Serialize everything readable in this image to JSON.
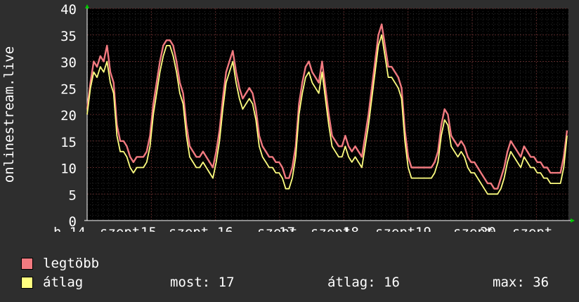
{
  "chart_data": {
    "type": "line",
    "ylabel": "onlinestream.live",
    "ylim": [
      0,
      40
    ],
    "yticks": [
      0,
      5,
      10,
      15,
      20,
      25,
      30,
      35,
      40
    ],
    "xtick_labels": [
      "h 14",
      "szept",
      "15",
      "szept",
      "16",
      "szept",
      "17",
      "szept",
      "18",
      "szept",
      "19",
      "szept",
      "20",
      "szept"
    ],
    "grid": true,
    "days": 7.5,
    "series": [
      {
        "name": "legtöbb",
        "color": "#f27a80",
        "values": [
          21,
          26,
          30,
          29,
          31,
          30,
          33,
          28,
          26,
          18,
          15,
          15,
          14,
          12,
          11,
          12,
          12,
          12,
          13,
          16,
          22,
          26,
          30,
          33,
          34,
          34,
          33,
          30,
          26,
          24,
          18,
          14,
          13,
          12,
          12,
          13,
          12,
          11,
          10,
          13,
          17,
          23,
          28,
          30,
          32,
          28,
          25,
          23,
          24,
          25,
          24,
          21,
          16,
          14,
          13,
          12,
          12,
          11,
          11,
          10,
          8,
          8,
          10,
          14,
          22,
          26,
          29,
          30,
          28,
          27,
          26,
          30,
          25,
          20,
          16,
          15,
          14,
          14,
          16,
          14,
          13,
          14,
          13,
          12,
          16,
          20,
          25,
          30,
          35,
          37,
          33,
          29,
          29,
          28,
          27,
          25,
          17,
          12,
          10,
          10,
          10,
          10,
          10,
          10,
          10,
          11,
          13,
          18,
          21,
          20,
          16,
          15,
          14,
          15,
          14,
          12,
          11,
          11,
          10,
          9,
          8,
          7,
          7,
          6,
          6,
          8,
          10,
          13,
          15,
          14,
          13,
          12,
          14,
          13,
          12,
          12,
          11,
          11,
          10,
          10,
          9,
          9,
          9,
          9,
          12,
          17
        ]
      },
      {
        "name": "átlag",
        "color": "#ffff80",
        "values": [
          20,
          25,
          28,
          27,
          29,
          28,
          30,
          26,
          24,
          16,
          13,
          13,
          12,
          10,
          9,
          10,
          10,
          10,
          11,
          14,
          20,
          24,
          28,
          31,
          33,
          33,
          31,
          28,
          24,
          22,
          16,
          12,
          11,
          10,
          10,
          11,
          10,
          9,
          8,
          11,
          15,
          21,
          26,
          28,
          30,
          26,
          23,
          21,
          22,
          23,
          22,
          19,
          14,
          12,
          11,
          10,
          10,
          9,
          9,
          8,
          6,
          6,
          8,
          12,
          20,
          24,
          27,
          28,
          26,
          25,
          24,
          28,
          23,
          18,
          14,
          13,
          12,
          12,
          14,
          12,
          11,
          12,
          11,
          10,
          14,
          18,
          23,
          28,
          33,
          35,
          31,
          27,
          27,
          26,
          25,
          23,
          15,
          10,
          8,
          8,
          8,
          8,
          8,
          8,
          8,
          9,
          11,
          16,
          19,
          18,
          14,
          13,
          12,
          13,
          12,
          10,
          9,
          9,
          8,
          7,
          6,
          5,
          5,
          5,
          5,
          6,
          8,
          11,
          13,
          12,
          11,
          10,
          12,
          11,
          10,
          10,
          9,
          9,
          8,
          8,
          7,
          7,
          7,
          7,
          10,
          16
        ]
      }
    ]
  },
  "legend": [
    {
      "label": "legtöbb",
      "color": "#f27a80"
    },
    {
      "label": "átlag",
      "color": "#ffff80"
    }
  ],
  "stats": {
    "now": "most: 17",
    "avg": "átlag: 16",
    "max": "max: 36"
  }
}
